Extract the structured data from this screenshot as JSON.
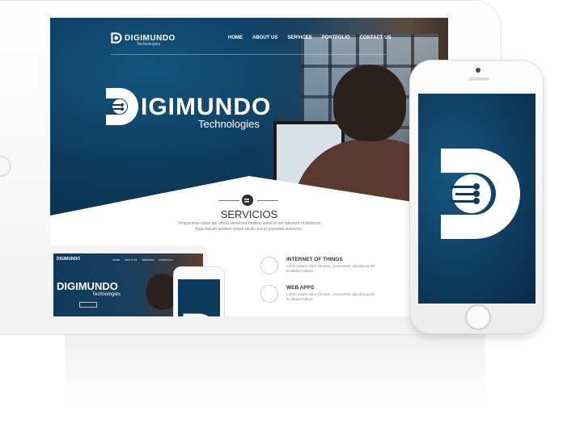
{
  "site": {
    "logo_text": "DIGIMUNDO",
    "logo_sub": "Technologies",
    "nav": [
      "HOME",
      "ABOUT US",
      "SERVICES",
      "PORTFOLIO",
      "CONTACT US"
    ],
    "brand_name": "IGIMUNDO",
    "brand_sub": "Technologies",
    "section_title": "SERVICIOS",
    "section_desc": "Temporibus culpa qui officia deserunt mollitia animi id est laborum et dolorum fuga harum quidem rerum facilis est et expedita distinctio.",
    "features": [
      {
        "title": "INTERNET OF THINGS",
        "desc": "Lorem ipsum dolor sit amet, consectetur adipisicing elit incididunt labore."
      },
      {
        "title": "WEB APPS",
        "desc": "Lorem ipsum dolor sit amet, consectetur adipisicing elit incididunt labore."
      }
    ]
  },
  "mini": {
    "logo_text": "DIGIMUNDO",
    "nav": [
      "HOME",
      "ABOUT US",
      "SERVICES",
      "PORTFOLIO"
    ],
    "brand_name": "DIGIMUNDO",
    "brand_sub": "Technologies"
  },
  "colors": {
    "brand_navy": "#0d3b5d",
    "white": "#ffffff"
  },
  "icons": [
    "digimundo-logo-icon",
    "servicios-icon",
    "iot-circle-icon",
    "web-apps-circle-icon"
  ]
}
